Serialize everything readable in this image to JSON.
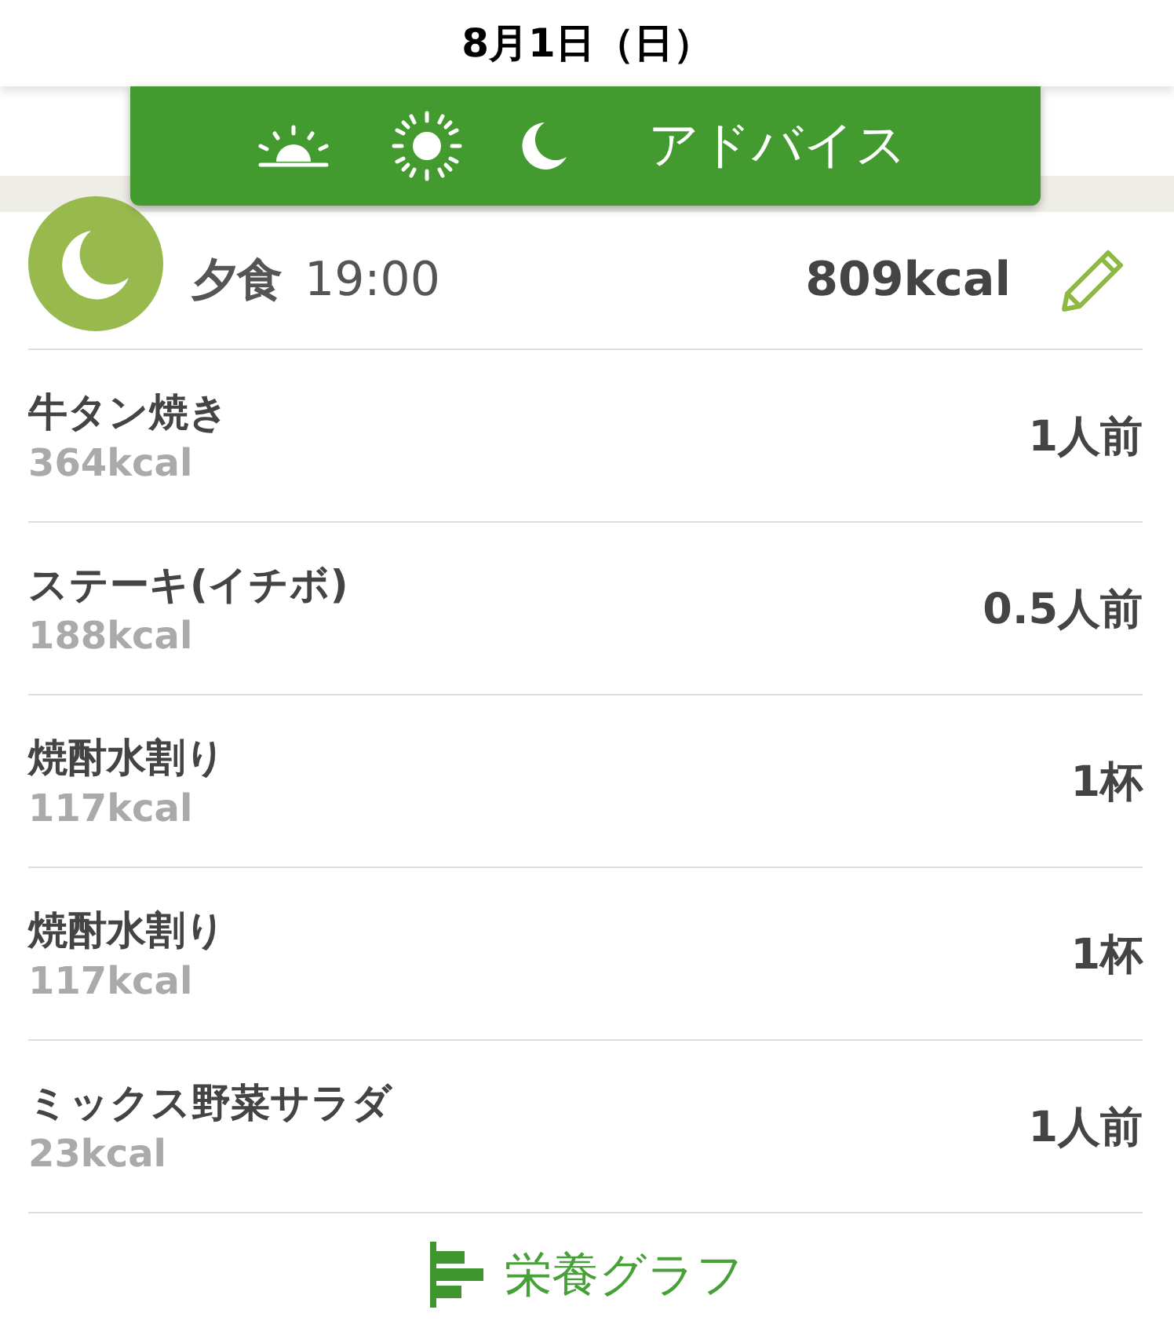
{
  "header": {
    "title": "8月1日（日）"
  },
  "meal_tabs": {
    "advice": "アドバイス"
  },
  "meal": {
    "name": "夕食",
    "time": "19:00",
    "total": "809kcal"
  },
  "foods": [
    {
      "name": "牛タン焼き",
      "kcal": "364kcal",
      "amount": "1人前"
    },
    {
      "name": "ステーキ(イチボ)",
      "kcal": "188kcal",
      "amount": "0.5人前"
    },
    {
      "name": "焼酎水割り",
      "kcal": "117kcal",
      "amount": "1杯"
    },
    {
      "name": "焼酎水割り",
      "kcal": "117kcal",
      "amount": "1杯"
    },
    {
      "name": "ミックス野菜サラダ",
      "kcal": "23kcal",
      "amount": "1人前"
    }
  ],
  "graph_link": "栄養グラフ"
}
